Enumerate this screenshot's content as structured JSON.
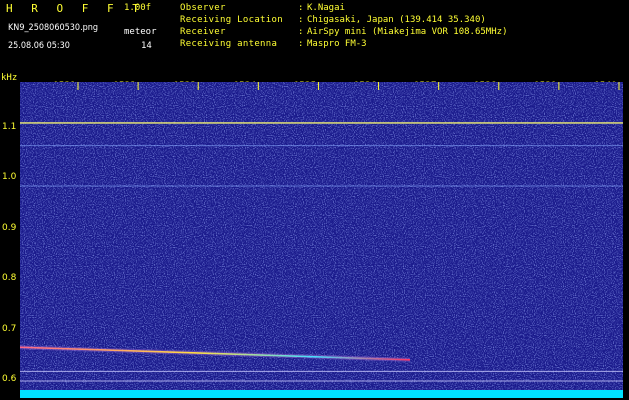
{
  "header": {
    "title": "H R O F F T",
    "version": "1.00f",
    "filename": "KN9_2508060530.png",
    "datetime": "25.08.06 05:30",
    "meteor_label": "meteor",
    "meteor_count": "14"
  },
  "info": [
    {
      "label": "Observer",
      "value": "K.Nagai"
    },
    {
      "label": "Receiving Location",
      "value": "Chigasaki, Japan (139.414 35.340)"
    },
    {
      "label": "Receiver",
      "value": "AirSpy mini (Miakejima VOR 108.65MHz)"
    },
    {
      "label": "Receiving antenna",
      "value": "Maspro FM-3"
    }
  ],
  "colors": {
    "background": "#000000",
    "plot_noise_base": "#1a1a8c",
    "text": "#ffff33",
    "carrier_line": "#dddd66",
    "meteor_trail": "#ff3366",
    "bottom_band": "#00e0ff"
  },
  "chart_data": {
    "type": "heatmap",
    "title": "",
    "ylabel": "kHz",
    "xlabel": "",
    "x_categories": [
      "0531",
      "0532",
      "0533",
      "0534",
      "0535",
      "0536",
      "0537",
      "0538",
      "0539",
      "0540"
    ],
    "y_ticks": [
      "1.1",
      "1.0",
      "0.9",
      "0.8",
      "0.7",
      "0.6"
    ],
    "ylim": [
      0.59,
      1.19
    ],
    "horizontal_lines_khz": [
      1.11,
      1.065,
      0.985,
      0.617,
      0.598
    ],
    "meteor_trail": {
      "x_start": "0530",
      "x_end": "0536.6",
      "khz_start": 0.665,
      "khz_end": 0.648
    },
    "grid": false
  }
}
